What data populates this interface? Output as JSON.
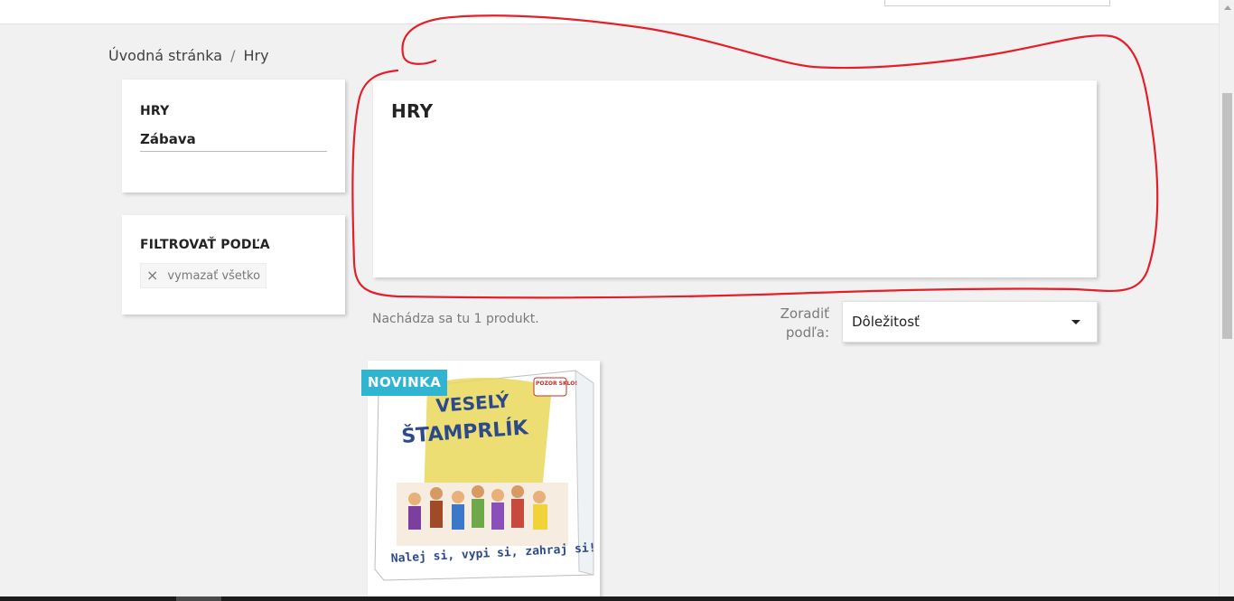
{
  "breadcrumb": {
    "home": "Úvodná stránka",
    "separator": "/",
    "current": "Hry"
  },
  "sidebar": {
    "category_title": "HRY",
    "category_link": "Zábava",
    "filter_title": "FILTROVAŤ PODĽA",
    "clear_all": "vymazať všetko"
  },
  "main": {
    "title": "HRY",
    "product_count": "Nachádza sa tu 1 produkt.",
    "sort_label": "Zoradiť podľa:",
    "sort_value": "Dôležitosť"
  },
  "product": {
    "badge": "NOVINKA",
    "box_title_line1": "VESELÝ",
    "box_title_line2": "ŠTAMPRLÍK",
    "box_sticker": "POZOR SKLO!",
    "box_tagline": "Nalej si, vypi si, zahraj si!"
  },
  "colors": {
    "badge": "#2fb5d2",
    "annotation": "#e3202a"
  }
}
